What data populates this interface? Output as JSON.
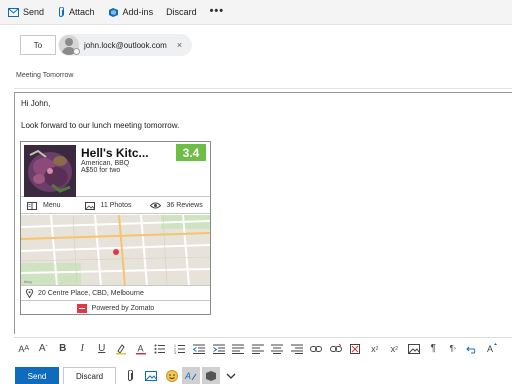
{
  "toolbar": {
    "send_label": "Send",
    "attach_label": "Attach",
    "addins_label": "Add-ins",
    "discard_label": "Discard",
    "more_label": "•••"
  },
  "recipients": {
    "to_label": "To",
    "to_address": "john.lock@outlook.com",
    "remove_glyph": "×"
  },
  "subject": "Meeting Tomorrow",
  "body": {
    "greeting": "Hi John,",
    "message": "Look forward to our lunch meeting tomorrow."
  },
  "card": {
    "restaurant_name": "Hell's Kitc...",
    "cuisine": "American, BBQ",
    "cost": "A$50 for two",
    "rating": "3.4",
    "rating_color": "#6dbe45",
    "menu_label": "Menu",
    "photos_label": "11 Photos",
    "reviews_label": "36 Reviews",
    "address": "20 Centre Place, CBD, Melbourne",
    "powered_by": "Powered by Zomato",
    "zomato_color": "#e23744"
  },
  "format_toolbar": {
    "icons": [
      "font-size-icon",
      "font-grow-icon",
      "bold-icon",
      "italic-icon",
      "underline-icon",
      "highlight-icon",
      "font-color-icon",
      "bullets-icon",
      "numbering-icon",
      "decrease-indent-icon",
      "increase-indent-icon",
      "quote-icon",
      "align-left-icon",
      "align-center-icon",
      "align-right-icon",
      "link-icon",
      "unlink-icon",
      "clear-format-icon",
      "superscript-icon",
      "subscript-icon",
      "image-icon",
      "paragraph-icon",
      "ltr-icon",
      "undo-icon",
      "more-icon"
    ]
  },
  "bottom_bar": {
    "send_label": "Send",
    "discard_label": "Discard",
    "accent_color": "#0f6cbd",
    "icons": [
      "attach-icon",
      "picture-icon",
      "emoji-icon",
      "editor-icon",
      "addins-icon",
      "chevron-down-icon"
    ]
  }
}
